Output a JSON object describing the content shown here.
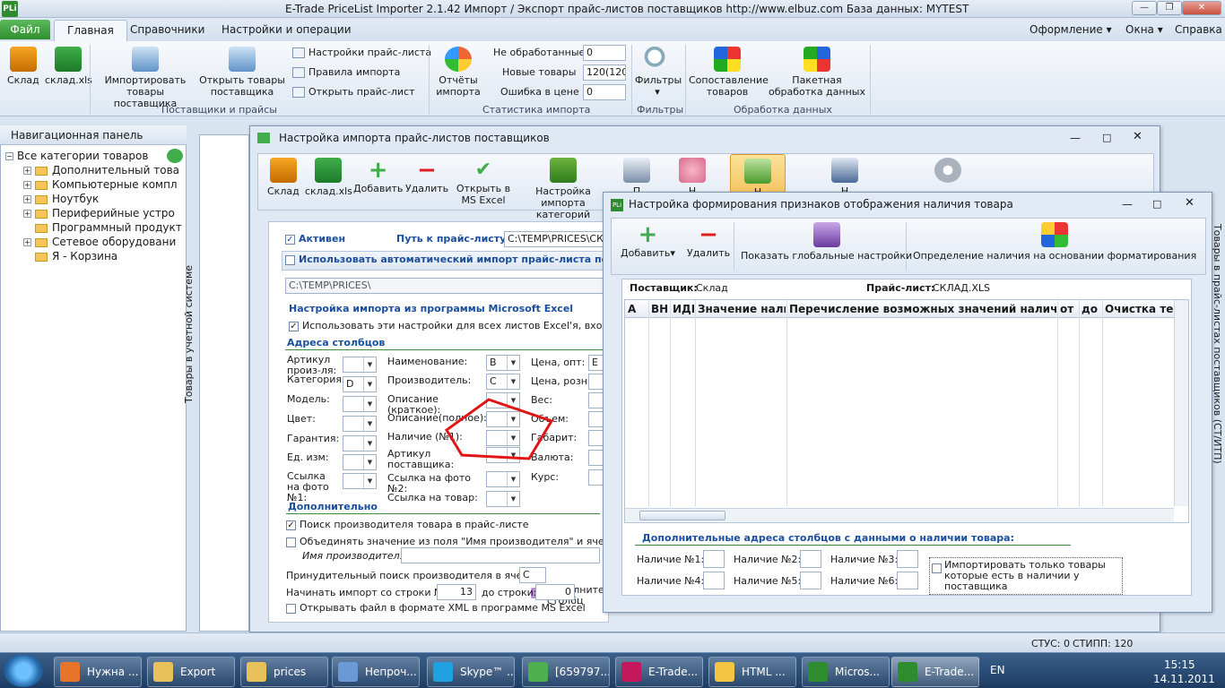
{
  "app": {
    "title": "E-Trade PriceList Importer 2.1.42   Импорт / Экспорт прайс-листов поставщиков   http://www.elbuz.com   База данных: MYTEST",
    "icon_label": "PLi"
  },
  "menu": {
    "file": "Файл",
    "tabs": [
      "Главная",
      "Справочники",
      "Настройки и операции"
    ],
    "right": [
      "Оформление",
      "Окна",
      "Справка"
    ]
  },
  "ribbon": {
    "sklad": "Склад",
    "sklad_xls": "склад.xls",
    "import_goods": "Импортировать товары поставщика",
    "open_goods": "Открыть товары поставщика",
    "price_settings": "Настройки прайс-листа",
    "import_rules": "Правила импорта",
    "open_price": "Открыть прайс-лист",
    "group_suppliers": "Поставщики и прайсы",
    "reports": "Отчёты импорта",
    "not_processed_label": "Не обработанные",
    "not_processed_value": "0",
    "new_goods_label": "Новые товары",
    "new_goods_value": "120(120)",
    "price_error_label": "Ошибка в цене",
    "price_error_value": "0",
    "group_stats": "Статистика импорта",
    "filters": "Фильтры",
    "group_filters": "Фильтры",
    "compare": "Сопоставление товаров",
    "batch": "Пакетная обработка данных",
    "group_processing": "Обработка данных"
  },
  "nav": {
    "header": "Навигационная панель",
    "root": "Все категории товаров",
    "items": [
      "Дополнительный това",
      "Компьютерные компл",
      "Ноутбук",
      "Периферийные устро",
      "Программный продукт",
      "Сетевое оборудовани",
      "Я - Корзина"
    ]
  },
  "side_tab": "Товары в учетной системе",
  "right_side_tab": "Товары в прайс-листах поставщиков (СТ/ИТП)",
  "import_win": {
    "title": "Настройка импорта прайс-листов поставщиков",
    "toolbar": [
      "Склад",
      "склад.xls",
      "Добавить",
      "Удалить",
      "Открыть в MS Excel",
      "Настройка импорта категорий",
      "П",
      "Н",
      "Н",
      "Н"
    ],
    "active_label": "Активен",
    "path_label": "Путь к прайс-листу:",
    "path_value": "C:\\TEMP\\PRICES\\СКЛ",
    "auto_import_label": "Использовать автоматический импорт прайс-листа поста",
    "auto_path": "C:\\TEMP\\PRICES\\",
    "excel_section": "Настройка импорта из программы Microsoft Excel",
    "use_all_sheets": "Использовать эти настройки для всех листов Excel'я, входящих",
    "columns_section": "Адреса столбцов",
    "col1": [
      "Артикул произ-ля:",
      "Категория:",
      "Модель:",
      "Цвет:",
      "Гарантия:",
      "Ед. изм:",
      "Ссылка на фото №1:"
    ],
    "col1_values": [
      "",
      "D",
      "",
      "",
      "",
      "",
      ""
    ],
    "col2": [
      "Наименование:",
      "Производитель:",
      "Описание (краткое):",
      "Описание(полное):",
      "Наличие (№1):",
      "Артикул поставщика:",
      "Ссылка на фото №2:",
      "Ссылка на товар:"
    ],
    "col2_values": [
      "B",
      "C",
      "",
      "",
      "",
      "",
      "",
      ""
    ],
    "col3": [
      "Цена, опт:",
      "Цена, розн.:",
      "Вес:",
      "Объем:",
      "Габарит:",
      "Валюта:",
      "Курс:"
    ],
    "col3_first_value": "E",
    "extra_cols": "Дополнител столбц",
    "additional_section": "Дополнительно",
    "search_vendor": "Поиск производителя товара в прайс-листе",
    "merge_vendor": "Объединять значение из поля \"Имя производителя\" и ячейки \"На",
    "vendor_name_label": "Имя производителя:",
    "force_search_label": "Принудительный поиск производителя в ячейке:",
    "force_search_value": "C",
    "start_row_label": "Начинать импорт со строки №:",
    "start_row_value": "13",
    "end_row_label": "до строки:",
    "end_row_value": "0",
    "open_xml": "Открывать файл в формате XML в программе MS Excel"
  },
  "avail_win": {
    "title": "Настройка формирования признаков отображения наличия товара",
    "toolbar": [
      "Добавить",
      "Удалить",
      "Показать глобальные настройки",
      "Определение наличия на основании форматирования"
    ],
    "supplier_label": "Поставщик:",
    "supplier_value": "Склад",
    "price_label": "Прайс-лист:",
    "price_value": "СКЛАД.XLS",
    "columns": [
      "A",
      "ВН",
      "ИДН",
      "Значение налич",
      "Перечисление возможных значений наличия",
      "от",
      "до",
      "Очистка текс"
    ],
    "extra_section": "Дополнительные адреса столбцов с данными о наличии товара:",
    "avail_labels": [
      "Наличие №1:",
      "Наличие №2:",
      "Наличие №3:",
      "Наличие №4:",
      "Наличие №5:",
      "Наличие №6:"
    ],
    "import_only": "Импортировать только товары которые есть в наличии у поставщика"
  },
  "status": {
    "stus": "СТУС: 0",
    "stipp": "СТИПП: 120"
  },
  "taskbar": {
    "items": [
      "Нужна ...",
      "Export",
      "prices",
      "Непроч...",
      "Skype™ ...",
      "[659797...",
      "E-Trade...",
      "HTML ...",
      "Micros...",
      "E-Trade..."
    ],
    "lang": "EN",
    "time": "15:15",
    "date": "14.11.2011"
  },
  "colors": {
    "accent_green": "#2f8f2f",
    "title_blue": "#1b4e9b",
    "red_annotation": "#e01515"
  }
}
